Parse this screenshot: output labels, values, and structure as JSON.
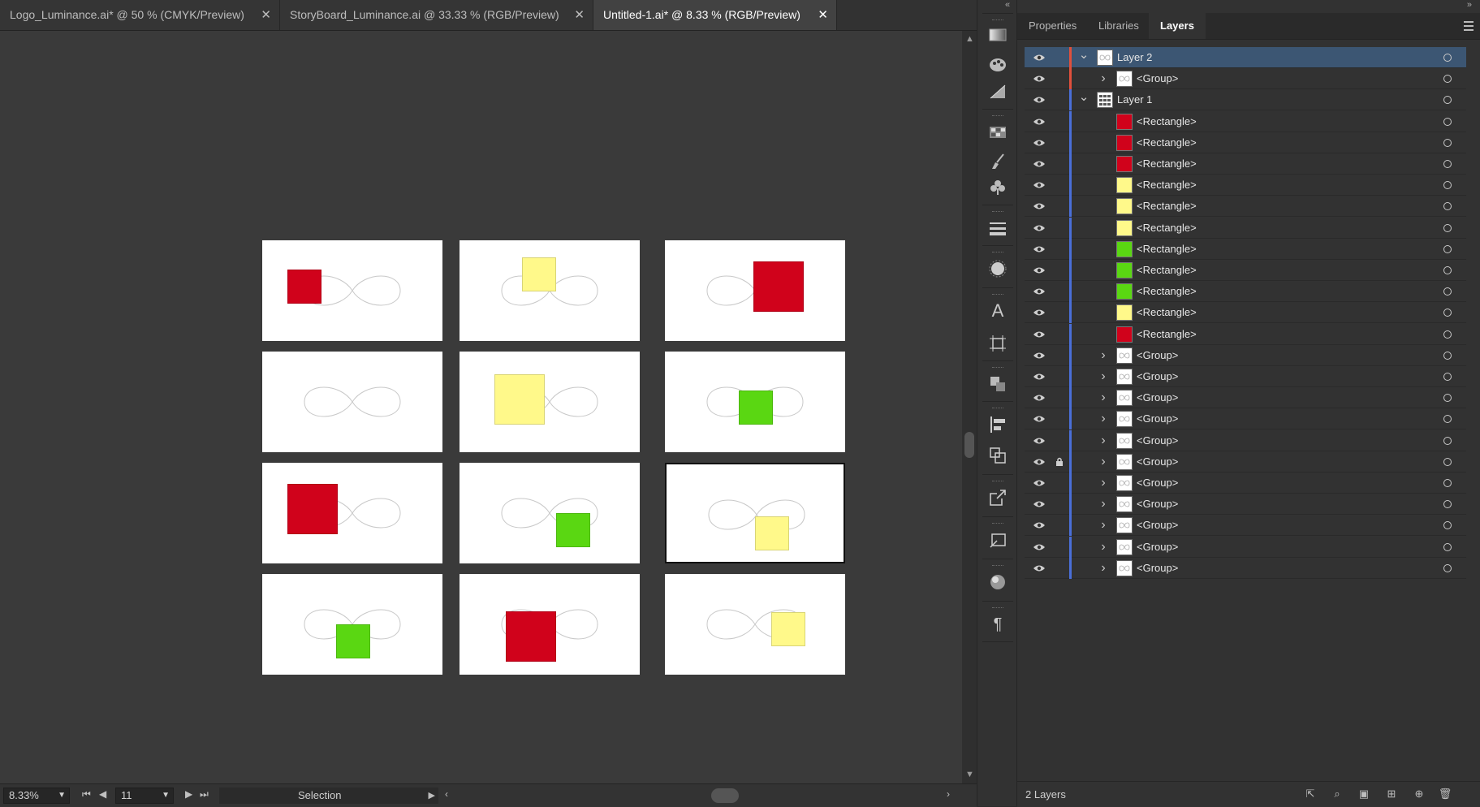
{
  "tabs": [
    {
      "label": "Logo_Luminance.ai* @ 50 % (CMYK/Preview)",
      "active": false
    },
    {
      "label": "StoryBoard_Luminance.ai @ 33.33 % (RGB/Preview)",
      "active": false
    },
    {
      "label": "Untitled-1.ai* @ 8.33 % (RGB/Preview)",
      "active": true
    }
  ],
  "tab_close_glyph": "✕",
  "colors": {
    "red": "#d0021b",
    "yellow": "#fff98a",
    "green": "#5ad712",
    "selection": "#3c5673",
    "layer2_bar": "#e0503c",
    "layer1_bar": "#4a6fd8"
  },
  "artboards": [
    {
      "square_color": "red"
    },
    {
      "square_color": "yellow"
    },
    {
      "square_color": "red"
    },
    {
      "square_color": "none"
    },
    {
      "square_color": "yellow"
    },
    {
      "square_color": "green"
    },
    {
      "square_color": "red"
    },
    {
      "square_color": "green"
    },
    {
      "square_color": "yellow",
      "selected": true
    },
    {
      "square_color": "green"
    },
    {
      "square_color": "red"
    },
    {
      "square_color": "yellow"
    }
  ],
  "status": {
    "zoom": "8.33%",
    "artboard_number": "11",
    "tool_name": "Selection"
  },
  "panel": {
    "tabs": [
      "Properties",
      "Libraries",
      "Layers"
    ],
    "active_tab": "Layers",
    "footer_text": "2 Layers",
    "menu_icon": "hamburger-menu-icon",
    "rows": [
      {
        "name": "Layer 2",
        "level": 0,
        "expander": "expanded",
        "thumb": "group",
        "bar": "layer2_bar",
        "selected": true,
        "locked": false
      },
      {
        "name": "<Group>",
        "level": 1,
        "expander": "collapsed",
        "thumb": "group",
        "bar": "layer2_bar",
        "selected": false,
        "locked": false
      },
      {
        "name": "Layer 1",
        "level": 0,
        "expander": "expanded",
        "thumb": "layer",
        "bar": "layer1_bar",
        "selected": false,
        "locked": false
      },
      {
        "name": "<Rectangle>",
        "level": 1,
        "expander": "none",
        "thumb": "red",
        "bar": "layer1_bar",
        "selected": false,
        "locked": false
      },
      {
        "name": "<Rectangle>",
        "level": 1,
        "expander": "none",
        "thumb": "red",
        "bar": "layer1_bar",
        "selected": false,
        "locked": false
      },
      {
        "name": "<Rectangle>",
        "level": 1,
        "expander": "none",
        "thumb": "red",
        "bar": "layer1_bar",
        "selected": false,
        "locked": false
      },
      {
        "name": "<Rectangle>",
        "level": 1,
        "expander": "none",
        "thumb": "yellow",
        "bar": "layer1_bar",
        "selected": false,
        "locked": false
      },
      {
        "name": "<Rectangle>",
        "level": 1,
        "expander": "none",
        "thumb": "yellow",
        "bar": "layer1_bar",
        "selected": false,
        "locked": false
      },
      {
        "name": "<Rectangle>",
        "level": 1,
        "expander": "none",
        "thumb": "yellow",
        "bar": "layer1_bar",
        "selected": false,
        "locked": false
      },
      {
        "name": "<Rectangle>",
        "level": 1,
        "expander": "none",
        "thumb": "green",
        "bar": "layer1_bar",
        "selected": false,
        "locked": false
      },
      {
        "name": "<Rectangle>",
        "level": 1,
        "expander": "none",
        "thumb": "green",
        "bar": "layer1_bar",
        "selected": false,
        "locked": false
      },
      {
        "name": "<Rectangle>",
        "level": 1,
        "expander": "none",
        "thumb": "green",
        "bar": "layer1_bar",
        "selected": false,
        "locked": false
      },
      {
        "name": "<Rectangle>",
        "level": 1,
        "expander": "none",
        "thumb": "yellow",
        "bar": "layer1_bar",
        "selected": false,
        "locked": false
      },
      {
        "name": "<Rectangle>",
        "level": 1,
        "expander": "none",
        "thumb": "red",
        "bar": "layer1_bar",
        "selected": false,
        "locked": false
      },
      {
        "name": "<Group>",
        "level": 1,
        "expander": "collapsed",
        "thumb": "group",
        "bar": "layer1_bar",
        "selected": false,
        "locked": false
      },
      {
        "name": "<Group>",
        "level": 1,
        "expander": "collapsed",
        "thumb": "group",
        "bar": "layer1_bar",
        "selected": false,
        "locked": false
      },
      {
        "name": "<Group>",
        "level": 1,
        "expander": "collapsed",
        "thumb": "group",
        "bar": "layer1_bar",
        "selected": false,
        "locked": false
      },
      {
        "name": "<Group>",
        "level": 1,
        "expander": "collapsed",
        "thumb": "group",
        "bar": "layer1_bar",
        "selected": false,
        "locked": false
      },
      {
        "name": "<Group>",
        "level": 1,
        "expander": "collapsed",
        "thumb": "group",
        "bar": "layer1_bar",
        "selected": false,
        "locked": false
      },
      {
        "name": "<Group>",
        "level": 1,
        "expander": "collapsed",
        "thumb": "group",
        "bar": "layer1_bar",
        "selected": false,
        "locked": true
      },
      {
        "name": "<Group>",
        "level": 1,
        "expander": "collapsed",
        "thumb": "group",
        "bar": "layer1_bar",
        "selected": false,
        "locked": false
      },
      {
        "name": "<Group>",
        "level": 1,
        "expander": "collapsed",
        "thumb": "group",
        "bar": "layer1_bar",
        "selected": false,
        "locked": false
      },
      {
        "name": "<Group>",
        "level": 1,
        "expander": "collapsed",
        "thumb": "group",
        "bar": "layer1_bar",
        "selected": false,
        "locked": false
      },
      {
        "name": "<Group>",
        "level": 1,
        "expander": "collapsed",
        "thumb": "group",
        "bar": "layer1_bar",
        "selected": false,
        "locked": false
      },
      {
        "name": "<Group>",
        "level": 1,
        "expander": "collapsed",
        "thumb": "group",
        "bar": "layer1_bar",
        "selected": false,
        "locked": false
      }
    ]
  },
  "toolstrip_icons": [
    "gradient-icon",
    "color-guide-icon",
    "transparency-icon",
    "swatches-icon",
    "brushes-icon",
    "symbols-icon",
    "stroke-icon",
    "appearance-icon",
    "character-icon",
    "artboards-icon",
    "pathfinder-icon",
    "align-icon",
    "transform-icon",
    "export-icon",
    "asset-export-icon",
    "graphic-styles-icon",
    "paragraph-icon"
  ]
}
